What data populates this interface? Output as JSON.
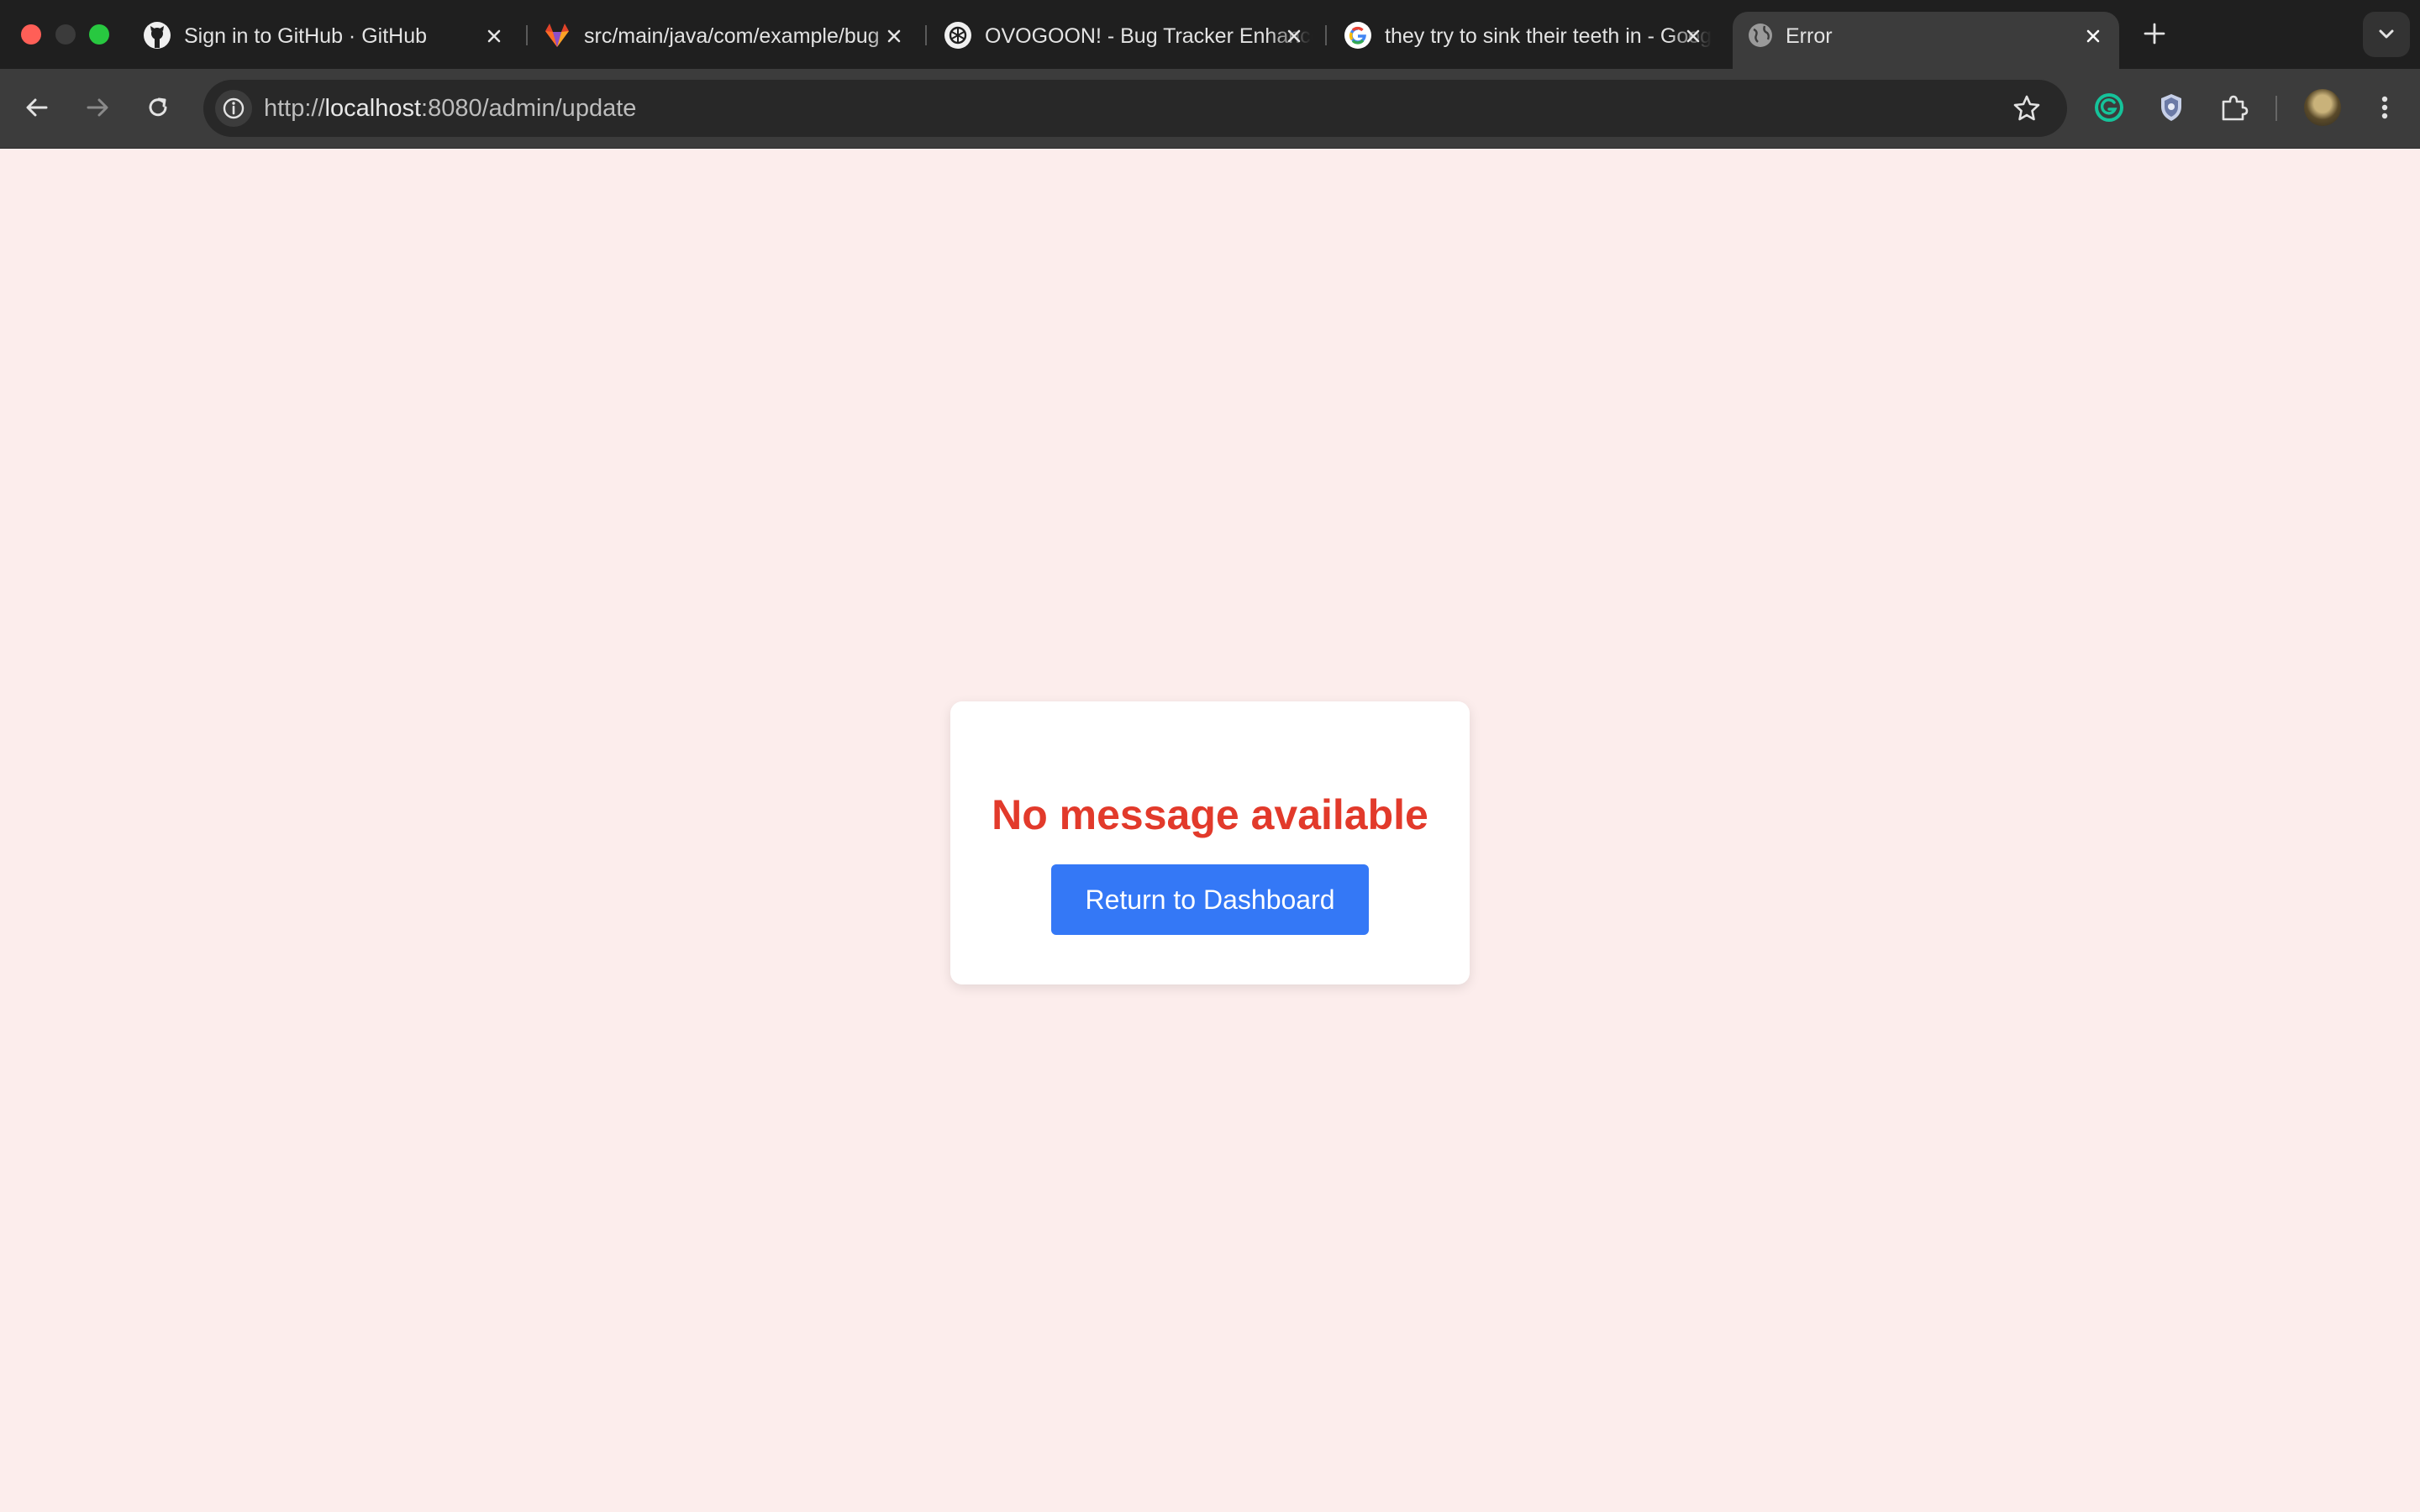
{
  "browser": {
    "tabs": [
      {
        "title": "Sign in to GitHub · GitHub",
        "favicon": "github-icon"
      },
      {
        "title": "src/main/java/com/example/bug",
        "favicon": "gitlab-icon"
      },
      {
        "title": "OVOGOON! - Bug Tracker Enhancement",
        "favicon": "openai-icon"
      },
      {
        "title": "they try to sink their teeth in - Google",
        "favicon": "google-icon"
      },
      {
        "title": "Error",
        "favicon": "globe-icon",
        "active": true
      }
    ],
    "address_bar": {
      "scheme": "http://",
      "host": "localhost",
      "path": ":8080/admin/update"
    },
    "colors": {
      "tabstrip": "#1f1f1f",
      "toolbar": "#3c3c3c",
      "omnibox": "#282828"
    }
  },
  "page": {
    "error_message": "No message available",
    "return_button_label": "Return to Dashboard",
    "colors": {
      "background": "#fcedec",
      "error_text": "#e23a2b",
      "button": "#3478f6"
    }
  }
}
